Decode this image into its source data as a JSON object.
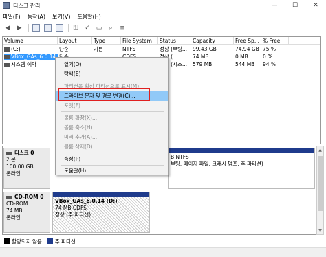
{
  "window": {
    "title": "디스크 관리",
    "min": "—",
    "max": "☐",
    "close": "✕"
  },
  "menu": [
    "파일(F)",
    "동작(A)",
    "보기(V)",
    "도움말(H)"
  ],
  "volume_table": {
    "headers": [
      "Volume",
      "Layout",
      "Type",
      "File System",
      "Status",
      "Capacity",
      "Free Sp...",
      "% Free"
    ],
    "rows": [
      {
        "volume": "(C:)",
        "layout": "단순",
        "type": "기본",
        "fs": "NTFS",
        "status": "정상 (부팅...",
        "capacity": "99.43 GB",
        "free": "74.94 GB",
        "pct": "75 %"
      },
      {
        "volume": "VBox_GAs_6.0.14...",
        "layout": "단순",
        "type": "",
        "fs": "CDFS",
        "status": "정상 (...",
        "capacity": "74 MB",
        "free": "0 MB",
        "pct": "0 %",
        "selected": true
      },
      {
        "volume": "시스템 예약",
        "layout": "",
        "type": "",
        "fs": "",
        "status": "정상 (시스...",
        "capacity": "579 MB",
        "free": "544 MB",
        "pct": "94 %"
      }
    ]
  },
  "context_menu": {
    "items": [
      {
        "label": "열기(O)",
        "disabled": false
      },
      {
        "label": "탐색(E)",
        "disabled": false
      },
      {
        "label": "파티션을 활성 파티션으로 표시(M)",
        "disabled": true
      },
      {
        "label": "드라이브 문자 및 경로 변경(C)...",
        "disabled": false,
        "highlighted": true
      },
      {
        "label": "포맷(F)...",
        "disabled": true
      },
      {
        "label": "볼륨 확장(X)...",
        "disabled": true
      },
      {
        "label": "볼륨 축소(H)...",
        "disabled": true
      },
      {
        "label": "미러 추가(A)...",
        "disabled": true
      },
      {
        "label": "볼륨 삭제(D)...",
        "disabled": true
      },
      {
        "label": "속성(P)",
        "disabled": false
      },
      {
        "label": "도움말(H)",
        "disabled": false
      }
    ]
  },
  "disks": [
    {
      "name": "디스크 0",
      "type": "기본",
      "size": "100.00 GB",
      "state": "온라인",
      "partition_text_1": "B NTFS",
      "partition_text_2": "부팅, 페이지 파일, 크래시 덤프, 주 파티션)"
    },
    {
      "name": "CD-ROM 0",
      "type": "CD-ROM",
      "size": "74 MB",
      "state": "온라인",
      "partition_name": "VBox_GAs_6.0.14 (D:)",
      "partition_size": "74 MB CDFS",
      "partition_state": "정상 (주 파티션)"
    }
  ],
  "legend": {
    "unallocated": "할당되지 않음",
    "primary": "주 파티션"
  },
  "colors": {
    "selection": "#3399ff",
    "menu_highlight": "#91c9f7",
    "partition_bar": "#1f3b8c",
    "red_annotation": "#e02020"
  }
}
